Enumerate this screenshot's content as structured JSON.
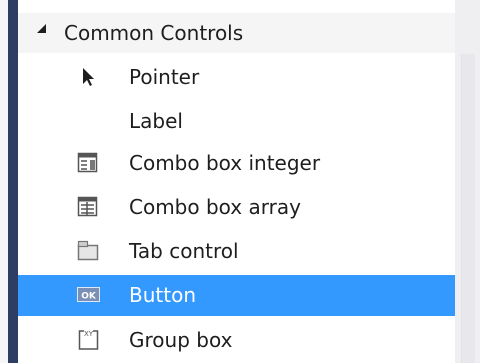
{
  "toolbox": {
    "group": {
      "label": "Common Controls",
      "expanded": true
    },
    "items": [
      {
        "label": "Pointer",
        "icon": "pointer-icon",
        "selected": false
      },
      {
        "label": "Label",
        "icon": "",
        "selected": false
      },
      {
        "label": "Combo box integer",
        "icon": "combo-box-integer-icon",
        "selected": false
      },
      {
        "label": "Combo box array",
        "icon": "combo-box-array-icon",
        "selected": false
      },
      {
        "label": "Tab control",
        "icon": "tab-control-icon",
        "selected": false
      },
      {
        "label": "Button",
        "icon": "button-icon",
        "selected": true,
        "icon_text": "OK"
      },
      {
        "label": "Group box",
        "icon": "group-box-icon",
        "selected": false,
        "icon_text": "XY"
      }
    ]
  },
  "colors": {
    "selection": "#3399ff",
    "side_bar": "#2e3d63",
    "text": "#1e1e1e"
  }
}
